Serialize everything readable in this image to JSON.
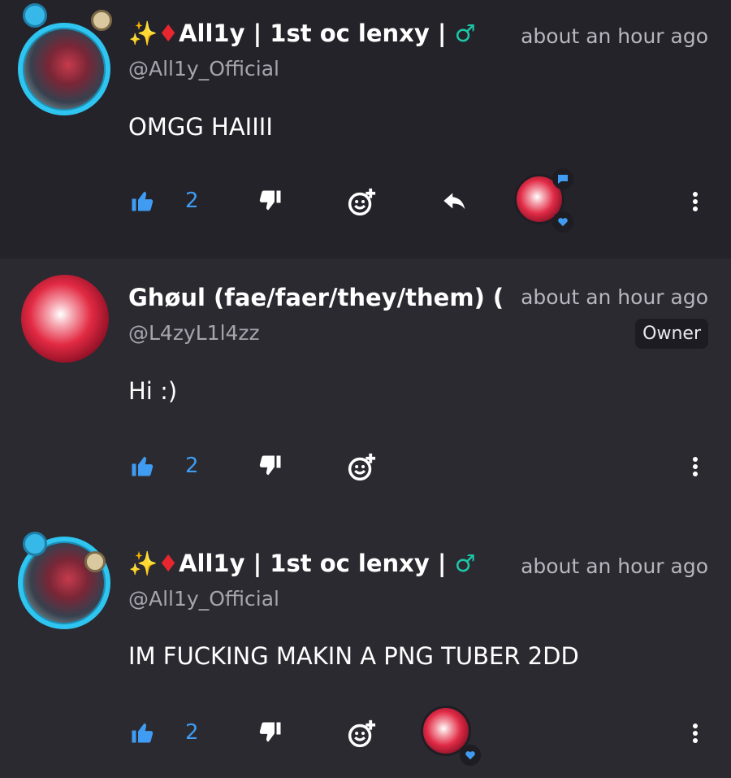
{
  "comments": [
    {
      "username": "✨🔶All1y | 1st oc lenxy | ♂",
      "username_parts": {
        "sparkle": "✨",
        "diamond": "♦",
        "name": "All1y | 1st oc lenxy | ",
        "symbol": "♂"
      },
      "handle": "@All1y_Official",
      "time": "about an hour ago",
      "text": "OMGG HAIIII",
      "likes": "2",
      "has_reply_button": true,
      "reaction_avatar": true
    },
    {
      "username": "Ghøul (fae/faer/they/them) (🌈",
      "handle": "@L4zyL1l4zz",
      "badge": "Owner",
      "time": "about an hour ago",
      "text": "Hi :)",
      "likes": "2",
      "has_reply_button": false,
      "reaction_avatar": false
    },
    {
      "username": "✨🔶All1y | 1st oc lenxy | ♂",
      "username_parts": {
        "sparkle": "✨",
        "diamond": "♦",
        "name": "All1y | 1st oc lenxy | ",
        "symbol": "♂"
      },
      "handle": "@All1y_Official",
      "time": "about an hour ago",
      "text": "IM FUCKING MAKIN A PNG TUBER 2DD",
      "likes": "2",
      "has_reply_button": false,
      "reaction_avatar": true
    }
  ],
  "icons": {
    "like": "thumbs-up-icon",
    "dislike": "thumbs-down-icon",
    "react": "add-emoji-icon",
    "reply": "reply-arrow-icon",
    "more": "more-vertical-icon",
    "chat_badge": "chat-bubble-icon",
    "heart_badge": "heart-icon"
  },
  "colors": {
    "background": "#24232a",
    "background_alt": "#2b2a31",
    "accent_blue": "#3f9cf2",
    "muted_text": "#a6a5ad"
  }
}
